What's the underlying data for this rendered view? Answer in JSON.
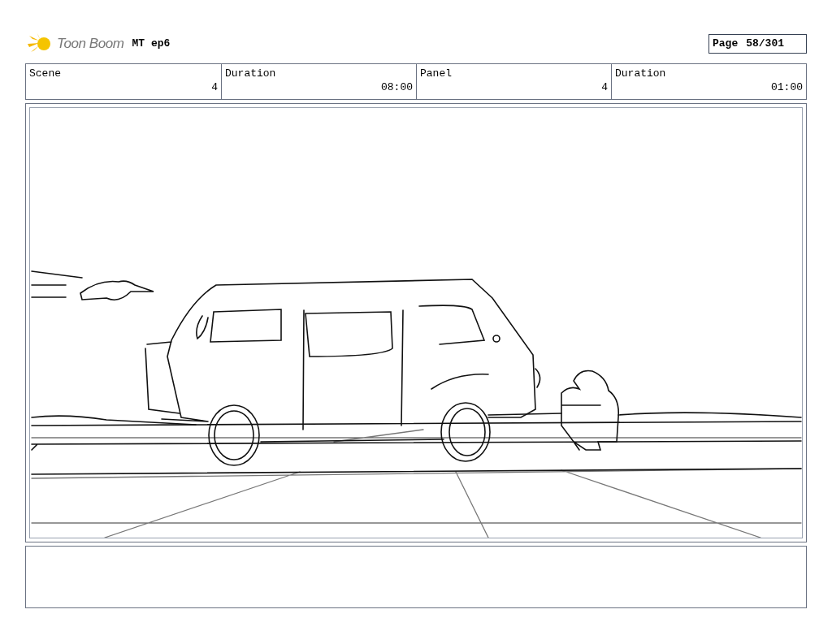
{
  "header": {
    "logo_text": "Toon Boom",
    "project": "MT ep6",
    "page_label": "Page",
    "page_number": "58/301"
  },
  "info_bar": [
    {
      "kind": "label",
      "text": "Scene"
    },
    {
      "kind": "value",
      "text": "4"
    },
    {
      "kind": "label",
      "text": "Duration"
    },
    {
      "kind": "value",
      "text": "08:00"
    },
    {
      "kind": "label",
      "text": "Panel"
    },
    {
      "kind": "value",
      "text": "4"
    },
    {
      "kind": "label",
      "text": "Duration"
    },
    {
      "kind": "value",
      "text": "01:00"
    }
  ]
}
